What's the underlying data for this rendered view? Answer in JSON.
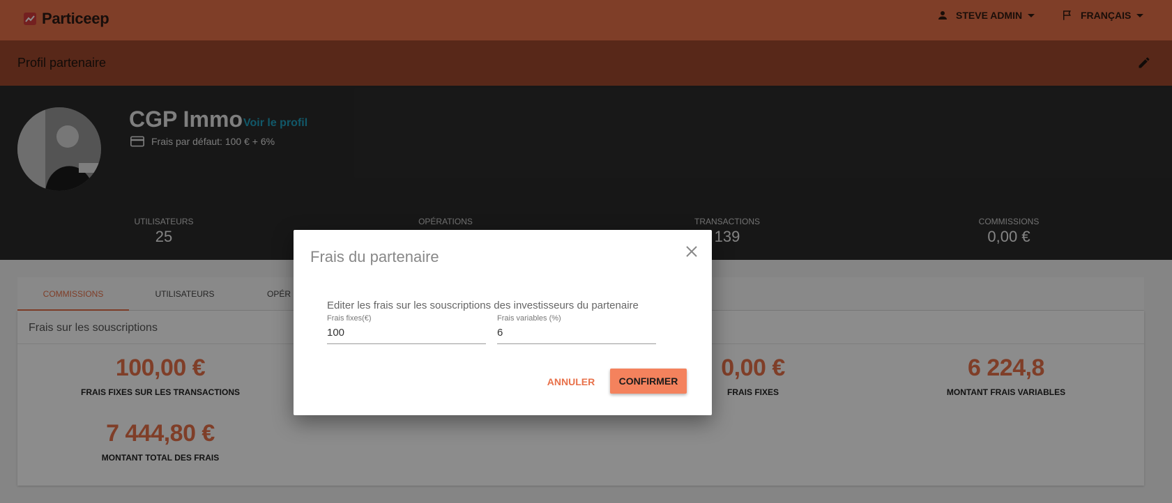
{
  "app": {
    "name": "Particeep"
  },
  "topbar": {
    "user_menu_label": "STEVE ADMIN",
    "language_menu_label": "FRANÇAIS"
  },
  "page": {
    "title": "Profil partenaire"
  },
  "partner": {
    "name": "CGP Immo",
    "view_profile_link": "Voir le profil",
    "default_fees": "Frais par défaut: 100 € + 6%"
  },
  "stats": [
    {
      "label": "UTILISATEURS",
      "value": "25"
    },
    {
      "label": "OPÉRATIONS",
      "value": ""
    },
    {
      "label": "TRANSACTIONS",
      "value": "139"
    },
    {
      "label": "COMMISSIONS",
      "value": "0,00 €"
    }
  ],
  "tabs": [
    {
      "label": "COMMISSIONS",
      "active": true
    },
    {
      "label": "UTILISATEURS",
      "active": false
    },
    {
      "label": "OPÉR",
      "active": false
    }
  ],
  "fees_card": {
    "title": "Frais sur les souscriptions",
    "metrics": [
      {
        "value": "100,00 €",
        "label": "FRAIS FIXES SUR LES TRANSACTIONS"
      },
      {
        "value": "0,00 €",
        "label": "FRAIS FIXES"
      },
      {
        "value": "6 224,8",
        "label": "MONTANT FRAIS VARIABLES"
      },
      {
        "value": "7 444,80 €",
        "label": "MONTANT TOTAL DES FRAIS"
      }
    ]
  },
  "modal": {
    "title": "Frais du partenaire",
    "description": "Editer les frais sur les souscriptions des investisseurs du partenaire",
    "fixed_fee_label": "Frais fixes(€)",
    "fixed_fee_value": "100",
    "variable_fee_label": "Frais variables (%)",
    "variable_fee_value": "6",
    "cancel_label": "ANNULER",
    "confirm_label": "CONFIRMER"
  },
  "colors": {
    "accent": "#e8714a",
    "subheader": "#a04a2e",
    "hero_bg": "#2b2b2b",
    "link": "#1fa0c0"
  }
}
